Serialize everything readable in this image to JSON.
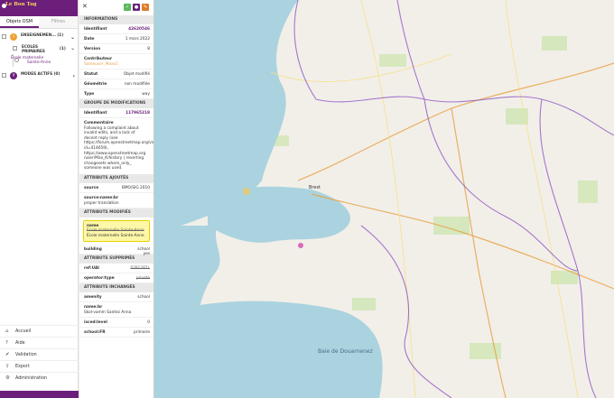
{
  "app": {
    "logo_text": "Le Bon Tag"
  },
  "left": {
    "tabs": [
      {
        "label": "Objets OSM"
      },
      {
        "label": "Filtres"
      }
    ],
    "groups": [
      {
        "badge": "!",
        "label": "ENSEIGNEMEN... (1)",
        "color": "#f0a030"
      },
      {
        "badge": "?",
        "label": "MODES ACTIFS (0)",
        "color": "#6b1f7a"
      }
    ],
    "subgroup": {
      "label": "ECOLES PRIMAIRES",
      "count": "(1)"
    },
    "item": {
      "label": "École maternelle Sainte-Anne"
    },
    "nav": [
      {
        "icon": "⌂",
        "label": "Accueil"
      },
      {
        "icon": "?",
        "label": "Aide"
      },
      {
        "icon": "✔",
        "label": "Validation"
      },
      {
        "icon": "⇪",
        "label": "Export"
      },
      {
        "icon": "⚙",
        "label": "Administration"
      }
    ]
  },
  "detail": {
    "sections": {
      "info": "INFORMATIONS",
      "changes": "GROUPE DE MODIFICATIONS",
      "added": "ATTRIBUTS AJOUTÉS",
      "modified": "ATTRIBUTS MODIFIÉS",
      "removed": "ATTRIBUTS SUPPRIMÉS",
      "unchanged": "ATTRIBUTS INCHANGÉS"
    },
    "info": [
      {
        "k": "Identifiant",
        "v": "42620546",
        "style": "link"
      },
      {
        "k": "Date",
        "v": "1 mars 2022",
        "style": ""
      },
      {
        "k": "Version",
        "v": "8",
        "style": ""
      }
    ],
    "contributor": {
      "k": "Contributeur",
      "v": "Someuser_Maxo1"
    },
    "info2": [
      {
        "k": "Statut",
        "v": "Objet modifié"
      },
      {
        "k": "Géométrie",
        "v": "non modifiée"
      },
      {
        "k": "Type",
        "v": "way"
      }
    ],
    "changeset": {
      "k": "Identifiant",
      "v": "117965218"
    },
    "comment": {
      "k": "Commentaire",
      "v": "Following a complaint about invalid edits, and a lack of decent reply (see https://forum.openstreetmap.org/viewtopic.php?id=414659), https://www.openstreetmap.org /user/Max_K/history | reverting changesets where_only_ someone was used."
    },
    "added": [
      {
        "k": "source",
        "v": "BMO/SIG 2010"
      },
      {
        "k": "source:name:br",
        "v": "proper translation"
      }
    ],
    "modified": {
      "k": "name",
      "old": "Ecole maternelle Sainte-Anne",
      "new": "École maternelle Sainte-Anne"
    },
    "modified2": {
      "k": "building",
      "v": "school yes"
    },
    "removed": [
      {
        "k": "ref:UAI",
        "v": "0291282L"
      },
      {
        "k": "operator:type",
        "v": "private"
      }
    ],
    "unchanged": [
      {
        "k": "amenity",
        "v": "school"
      },
      {
        "k": "name:br",
        "v": "Skol-vamm Santez Anna"
      },
      {
        "k": "isced:level",
        "v": "0"
      },
      {
        "k": "school:FR",
        "v": "primaire"
      }
    ]
  },
  "map": {
    "label_bay": "Baie de Douarnenez",
    "label_city": "Brest"
  },
  "colors": {
    "brand": "#6b1f7a",
    "accent": "#f0a030",
    "sea": "#aad3df",
    "land": "#f2efe9"
  }
}
